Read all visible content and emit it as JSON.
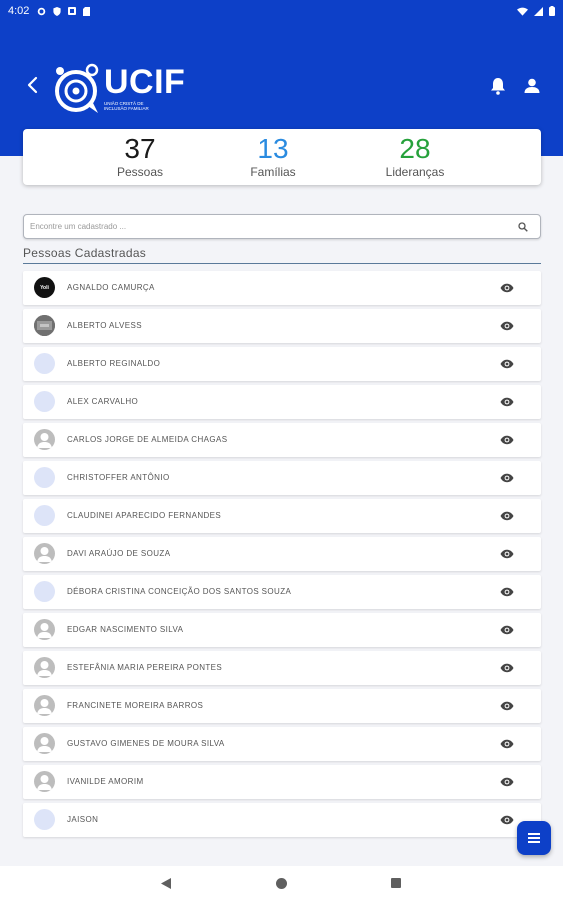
{
  "status_bar": {
    "time": "4:02"
  },
  "header": {
    "logo_title": "UCIF",
    "logo_subtitle": "UNIÃO CRISTÃ DE INCLUSÃO FAMILIAR"
  },
  "stats": [
    {
      "value": "37",
      "label": "Pessoas",
      "color": "#1a1a1a"
    },
    {
      "value": "13",
      "label": "Famílias",
      "color": "#2a8be0"
    },
    {
      "value": "28",
      "label": "Lideranças",
      "color": "#26a13b"
    }
  ],
  "search": {
    "placeholder": "Encontre um cadastrado ..."
  },
  "section_title": "Pessoas Cadastradas",
  "people": [
    {
      "name": "AGNALDO CAMURÇA",
      "avatar": "dark",
      "avatar_text": "Yoli"
    },
    {
      "name": "ALBERTO ALVESS",
      "avatar": "photo"
    },
    {
      "name": "ALBERTO REGINALDO",
      "avatar": "light"
    },
    {
      "name": "ALEX CARVALHO",
      "avatar": "light"
    },
    {
      "name": "CARLOS JORGE DE ALMEIDA CHAGAS",
      "avatar": "default"
    },
    {
      "name": "CHRISTOFFER ANTÔNIO",
      "avatar": "light"
    },
    {
      "name": "CLAUDINEI APARECIDO FERNANDES",
      "avatar": "light"
    },
    {
      "name": "DAVI ARAÚJO DE SOUZA",
      "avatar": "default"
    },
    {
      "name": "DÉBORA CRISTINA CONCEIÇÃO DOS SANTOS SOUZA",
      "avatar": "light"
    },
    {
      "name": "EDGAR NASCIMENTO SILVA",
      "avatar": "default"
    },
    {
      "name": "ESTEFÂNIA MARIA PEREIRA PONTES",
      "avatar": "default"
    },
    {
      "name": "FRANCINETE MOREIRA BARROS",
      "avatar": "default"
    },
    {
      "name": "GUSTAVO GIMENES DE MOURA SILVA",
      "avatar": "default"
    },
    {
      "name": "IVANILDE AMORIM",
      "avatar": "default"
    },
    {
      "name": "JAISON",
      "avatar": "light"
    }
  ],
  "colors": {
    "brand_blue": "#0d40c8",
    "background": "#f3f4f8"
  },
  "icons": {
    "header": [
      "back-arrow-icon",
      "bell-icon",
      "user-icon"
    ],
    "row": "eye-icon",
    "fab": "menu-icon",
    "search": "search-icon"
  }
}
